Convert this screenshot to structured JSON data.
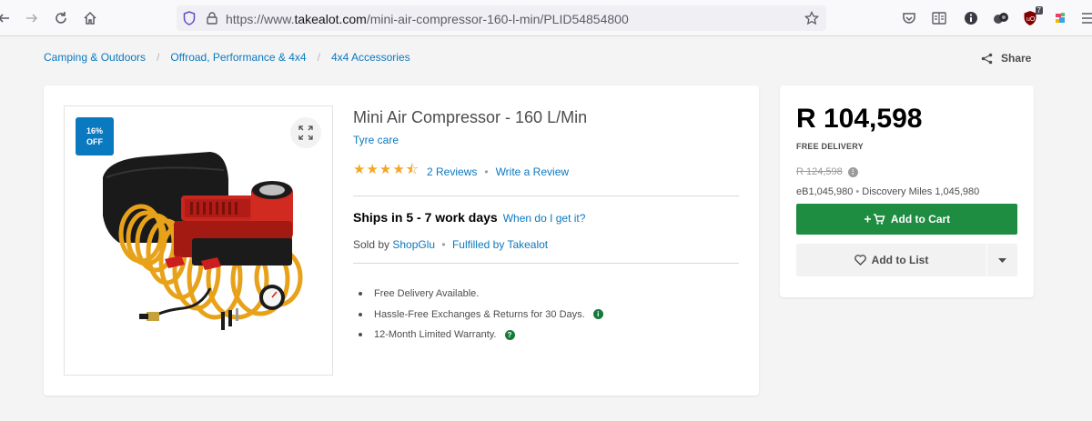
{
  "browser": {
    "url_prefix": "https://www.",
    "url_domain": "takealot.com",
    "url_path": "/mini-air-compressor-160-l-min/PLID54854800",
    "extension_badge": "7",
    "icons": [
      "back-arrow-icon",
      "forward-arrow-icon",
      "reload-icon",
      "home-icon",
      "shield-icon",
      "lock-icon",
      "bookmark-star-icon",
      "pocket-icon",
      "reader-icon",
      "info-icon",
      "extension-icon",
      "ublock-icon",
      "extension-color-icon",
      "menu-icon"
    ]
  },
  "breadcrumb": {
    "items": [
      "Camping & Outdoors",
      "Offroad, Performance & 4x4",
      "4x4 Accessories"
    ],
    "separator": "/"
  },
  "share_label": "Share",
  "product": {
    "discount_line1": "16%",
    "discount_line2": "OFF",
    "title": "Mini Air Compressor - 160 L/Min",
    "subcategory": "Tyre care",
    "stars": "★★★★⯪",
    "rating": 4.5,
    "reviews_label": "2 Reviews",
    "write_review_label": "Write a Review",
    "ships_label": "Ships in 5 - 7 work days",
    "when_label": "When do I get it?",
    "sold_by_prefix": "Sold by",
    "seller": "ShopGlu",
    "fulfilled_label": "Fulfilled by Takealot",
    "features": [
      "Free Delivery Available.",
      "Hassle-Free Exchanges & Returns for 30 Days.",
      "12-Month Limited Warranty."
    ]
  },
  "buy_box": {
    "price": "R 104,598",
    "free_delivery": "FREE DELIVERY",
    "old_price": "R 124,598",
    "ebucks": "eB1,045,980",
    "discovery": "Discovery Miles 1,045,980",
    "add_to_cart": "Add to Cart",
    "add_to_list": "Add to List"
  },
  "colors": {
    "link": "#0b79bf",
    "cart_green": "#1e8c41",
    "badge_blue": "#0b79bf",
    "star": "#f5a623"
  }
}
